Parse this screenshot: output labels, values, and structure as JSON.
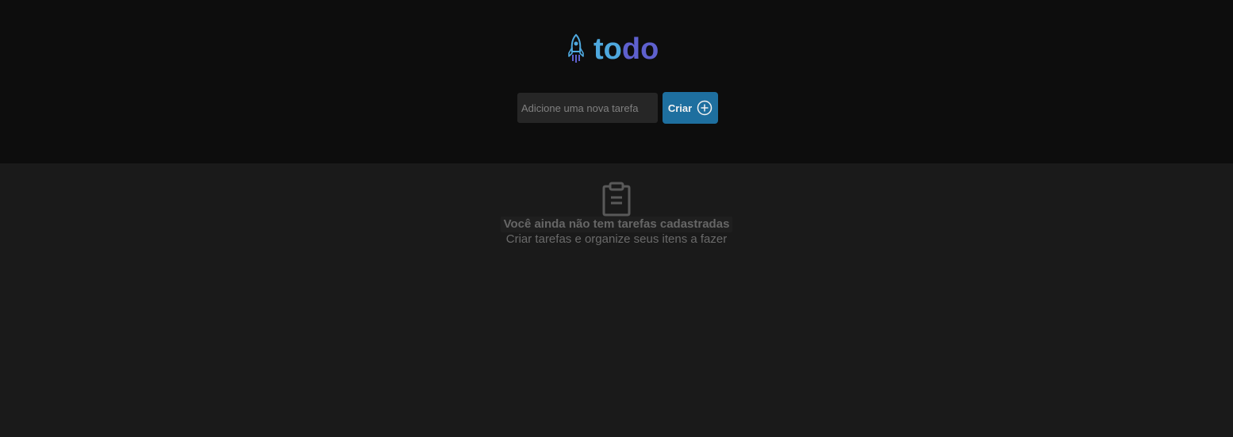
{
  "brand": {
    "name_part1": "to",
    "name_part2": "do",
    "icon": "rocket-icon",
    "color_part1": "#4ea8de",
    "color_part2": "#5e60ce"
  },
  "new_task": {
    "placeholder": "Adicione uma nova tarefa",
    "value": "",
    "button_label": "Criar",
    "button_icon": "plus-circle-icon",
    "button_color": "#1e6f9f"
  },
  "empty_state": {
    "icon": "clipboard-icon",
    "title": "Você ainda não tem tarefas cadastradas",
    "subtitle": "Criar tarefas e organize seus itens a fazer"
  }
}
